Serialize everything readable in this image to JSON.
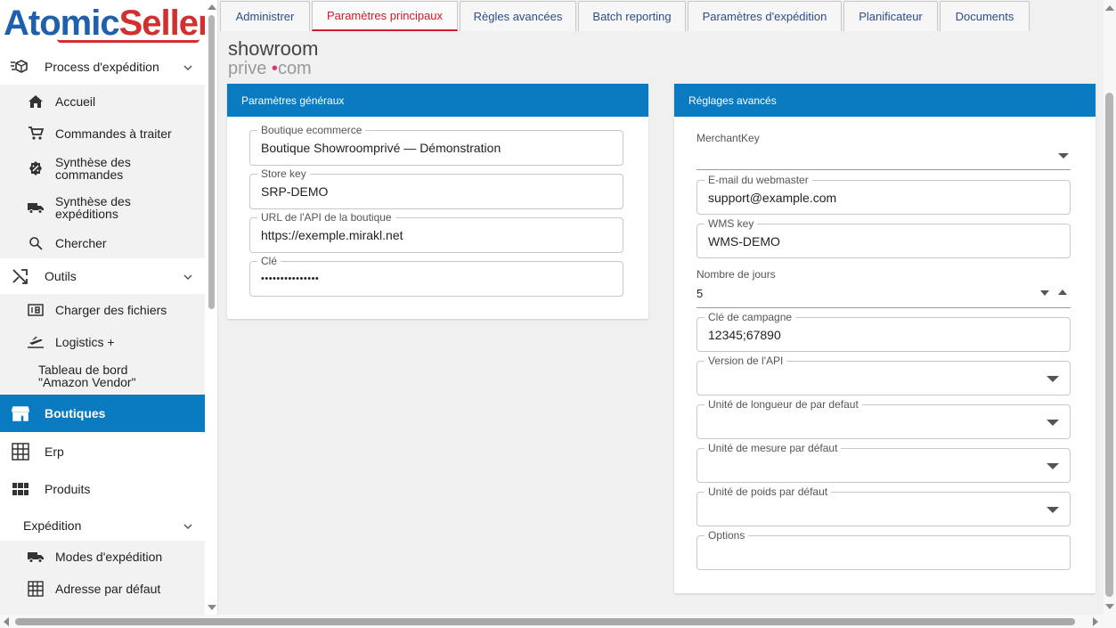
{
  "logo": {
    "part1": "Atomic",
    "part2": "Seller"
  },
  "sidebar": {
    "process": {
      "label": "Process d'expédition",
      "items": [
        {
          "label": "Accueil"
        },
        {
          "label": "Commandes à traiter"
        },
        {
          "label": "Synthèse des commandes"
        },
        {
          "label": "Synthèse des expéditions"
        },
        {
          "label": "Chercher"
        }
      ]
    },
    "outils": {
      "label": "Outils",
      "items": [
        {
          "label": "Charger des fichiers"
        },
        {
          "label": "Logistics +"
        },
        {
          "label": "Tableau de bord \"Amazon Vendor\""
        }
      ]
    },
    "boutiques": {
      "label": "Boutiques"
    },
    "erp": {
      "label": "Erp"
    },
    "produits": {
      "label": "Produits"
    },
    "expedition": {
      "label": "Expédition",
      "items": [
        {
          "label": "Modes d'expédition"
        },
        {
          "label": "Adresse par défaut"
        }
      ]
    }
  },
  "tabs": [
    {
      "label": "Administrer"
    },
    {
      "label": "Paramètres principaux"
    },
    {
      "label": "Règles avancées"
    },
    {
      "label": "Batch reporting"
    },
    {
      "label": "Paramètres d'expédition"
    },
    {
      "label": "Planificateur"
    },
    {
      "label": "Documents"
    }
  ],
  "shop_logo": {
    "line1": "showroom",
    "line2a": "prive",
    "dot": "•",
    "line2b": "com"
  },
  "general": {
    "title": "Paramètres généraux",
    "fields": [
      {
        "label": "Boutique ecommerce",
        "value": "Boutique Showroomprivé — Démonstration"
      },
      {
        "label": "Store key",
        "value": "SRP-DEMO"
      },
      {
        "label": "URL de l'API de la boutique",
        "value": "https://exemple.mirakl.net"
      },
      {
        "label": "Clé",
        "value": "•••••••••••••••"
      }
    ]
  },
  "advanced": {
    "title": "Réglages avancés",
    "merchant_key": {
      "label": "MerchantKey",
      "value": ""
    },
    "webmaster_email": {
      "label": "E-mail du webmaster",
      "value": "support@example.com"
    },
    "wms_key": {
      "label": "WMS key",
      "value": "WMS-DEMO"
    },
    "nombre_jours": {
      "label": "Nombre de jours",
      "value": "5"
    },
    "cle_campagne": {
      "label": "Clé de campagne",
      "value": "12345;67890"
    },
    "version_api": {
      "label": "Version de l'API",
      "value": ""
    },
    "unite_longueur": {
      "label": "Unité de longueur de par defaut",
      "value": ""
    },
    "unite_mesure": {
      "label": "Unité de mesure par défaut",
      "value": ""
    },
    "unite_poids": {
      "label": "Unité de poids par défaut",
      "value": ""
    },
    "options": {
      "label": "Options",
      "value": ""
    }
  },
  "colors": {
    "primary": "#0b7bc1",
    "accent": "#cc1b2b",
    "brand_blue": "#1e5fae"
  }
}
